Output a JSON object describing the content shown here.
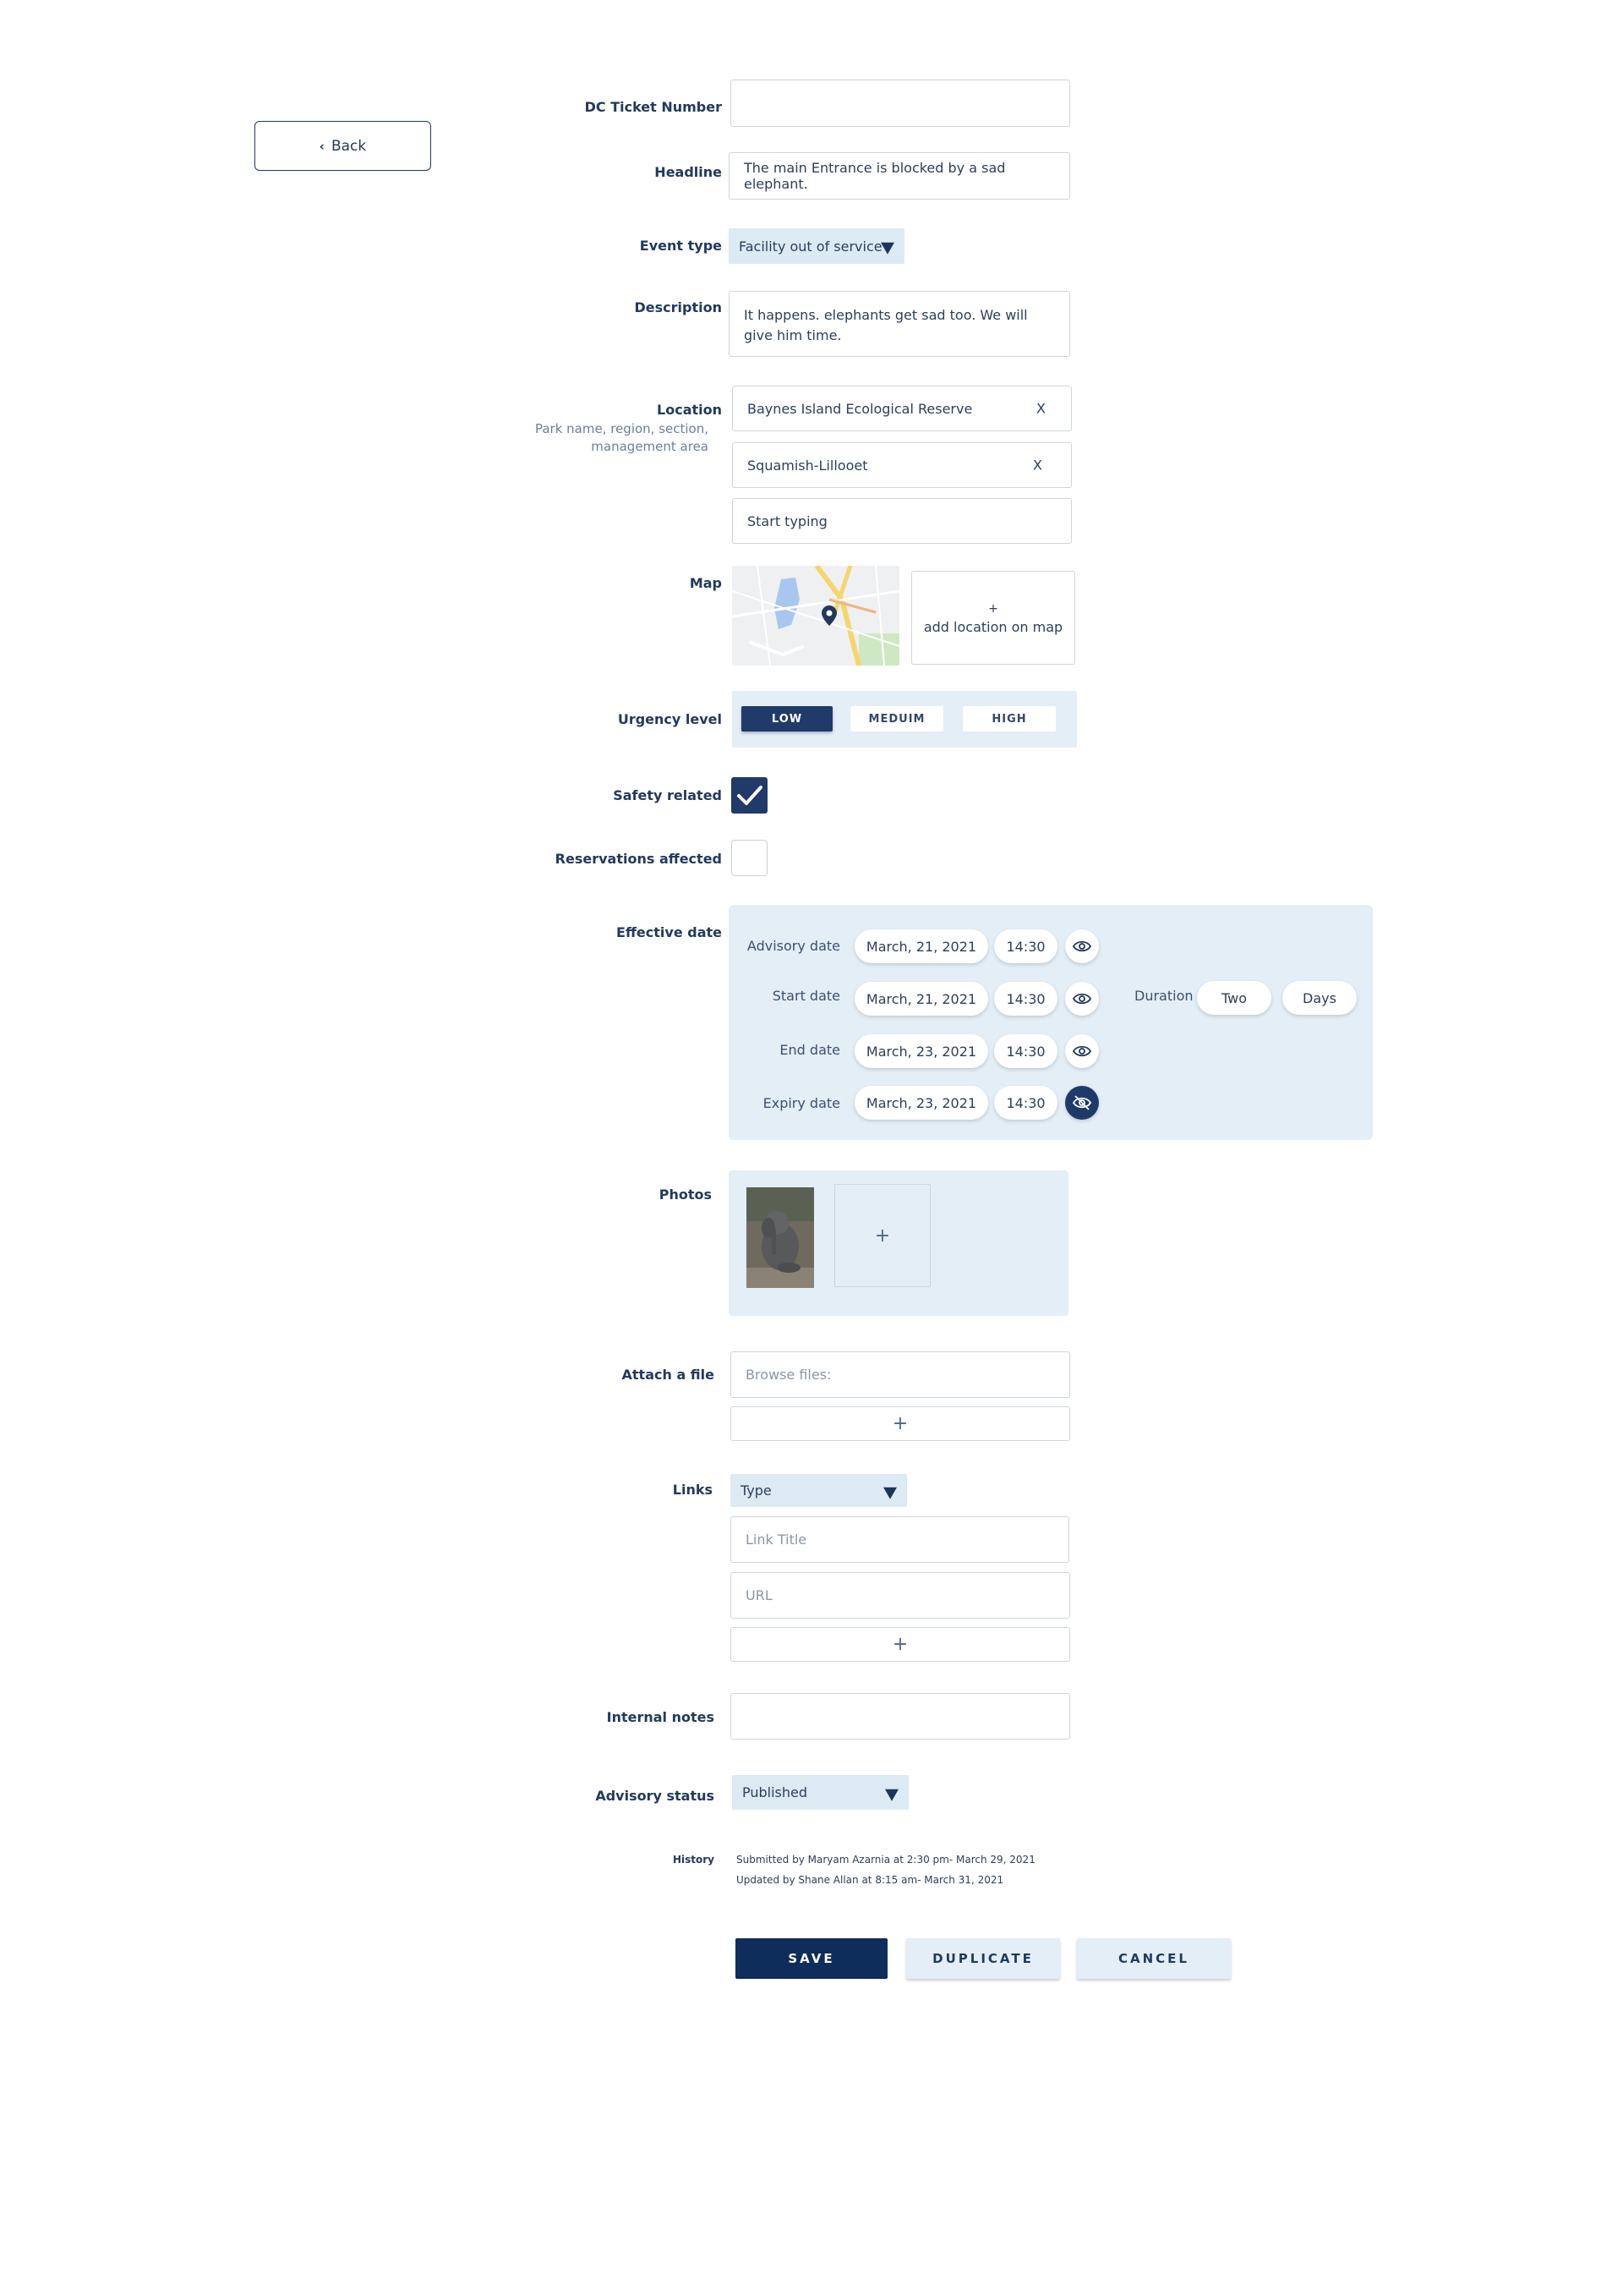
{
  "back_label": "Back",
  "fields": {
    "dc_ticket": {
      "label": "DC Ticket Number",
      "value": ""
    },
    "headline": {
      "label": "Headline",
      "value": "The main Entrance is blocked by a sad elephant."
    },
    "event_type": {
      "label": "Event type",
      "value": "Facility out of service"
    },
    "description": {
      "label": "Description",
      "value": "It happens. elephants get sad too.  We will give him time."
    },
    "location": {
      "label": "Location",
      "hint": "Park name, region, section, management area",
      "chips": [
        {
          "text": "Baynes Island Ecological Reserve",
          "remove": "X"
        },
        {
          "text": "Squamish-Lillooet",
          "remove": "X"
        }
      ],
      "input_placeholder": "Start typing"
    },
    "map": {
      "label": "Map",
      "add_plus": "+",
      "add_text": "add location on map"
    },
    "urgency": {
      "label": "Urgency level",
      "options": [
        "LOW",
        "MEDUIM",
        "HIGH"
      ],
      "selected": "LOW"
    },
    "safety": {
      "label": "Safety related",
      "checked": true
    },
    "reservations": {
      "label": "Reservations affected",
      "checked": false
    }
  },
  "effective_date": {
    "label": "Effective date",
    "rows": [
      {
        "label": "Advisory date",
        "date": "March, 21, 2021",
        "time": "14:30",
        "visible": true
      },
      {
        "label": "Start date",
        "date": "March, 21, 2021",
        "time": "14:30",
        "visible": true
      },
      {
        "label": "End date",
        "date": "March, 23, 2021",
        "time": "14:30",
        "visible": true
      },
      {
        "label": "Expiry date",
        "date": "March, 23, 2021",
        "time": "14:30",
        "visible": false
      }
    ],
    "duration": {
      "label": "Duration",
      "amount": "Two",
      "unit": "Days"
    }
  },
  "photos": {
    "label": "Photos",
    "add": "+"
  },
  "attach": {
    "label": "Attach a file",
    "placeholder": "Browse files:",
    "add": "+"
  },
  "links": {
    "label": "Links",
    "type": "Type",
    "title_placeholder": "Link Title",
    "url_placeholder": "URL",
    "add": "+"
  },
  "internal_notes": {
    "label": "Internal notes",
    "value": ""
  },
  "advisory_status": {
    "label": "Advisory status",
    "value": "Published"
  },
  "history": {
    "label": "History",
    "lines": [
      "Submitted by Maryam Azarnia at 2:30 pm- March 29, 2021",
      "Updated by Shane Allan at 8:15 am- March 31, 2021"
    ]
  },
  "actions": {
    "save": "SAVE",
    "duplicate": "DUPLICATE",
    "cancel": "CANCEL"
  },
  "colors": {
    "primary": "#0f2d5a",
    "light_panel": "#e3eef6",
    "text": "#223a5e"
  }
}
